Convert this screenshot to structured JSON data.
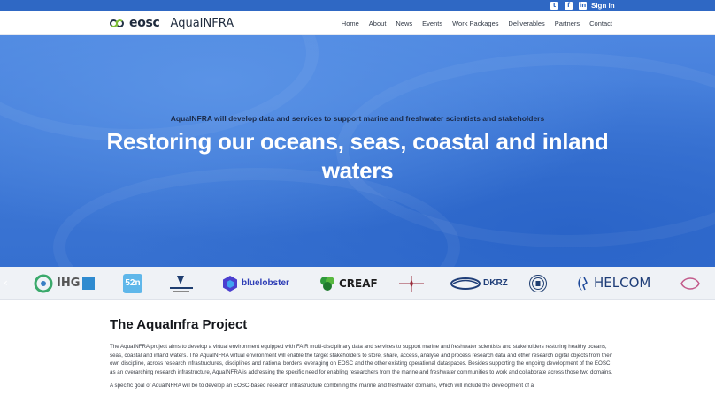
{
  "topbar": {
    "social_icons": [
      "twitter-icon",
      "facebook-icon",
      "linkedin-icon"
    ],
    "signin_label": "Sign in"
  },
  "header": {
    "logo_text": "eosc",
    "project_name": "AquaINFRA",
    "nav": [
      "Home",
      "About",
      "News",
      "Events",
      "Work Packages",
      "Deliverables",
      "Partners",
      "Contact"
    ]
  },
  "hero": {
    "subtitle": "AquaINFRA will develop data and services to support marine and freshwater scientists and stakeholders",
    "title": "Restoring our oceans, seas, coastal and inland waters"
  },
  "partners": {
    "logos": [
      "IHG",
      "52n",
      "bluelobster",
      "CREAF",
      "DKRZ",
      "HELCOM"
    ]
  },
  "project": {
    "heading": "The AquaInfra Project",
    "paragraph_1": "The AquaINFRA project aims to develop a virtual environment equipped with FAIR multi-disciplinary data and services to support marine and freshwater scientists and stakeholders restoring healthy oceans, seas, coastal and inland waters. The AquaINFRA virtual environment will enable the target stakeholders to store, share, access, analyse and process research data and other research digital objects from their own discipline, across research infrastructures, disciplines and national borders leveraging on EOSC and the other existing operational dataspaces. Besides supporting the ongoing development of the EOSC as an overarching research infrastructure, AquaINFRA is addressing the specific need for enabling researchers from the marine and freshwater communities to work and collaborate across those two domains.",
    "paragraph_2": "A specific goal of AquaINFRA will be to develop an EOSC-based research infrastructure combining the marine and freshwater domains, which will include the development of a"
  },
  "colors": {
    "accent": "#2f68c4",
    "hero_blue": "#3e78d6",
    "eosc_green": "#7fbf3a"
  }
}
